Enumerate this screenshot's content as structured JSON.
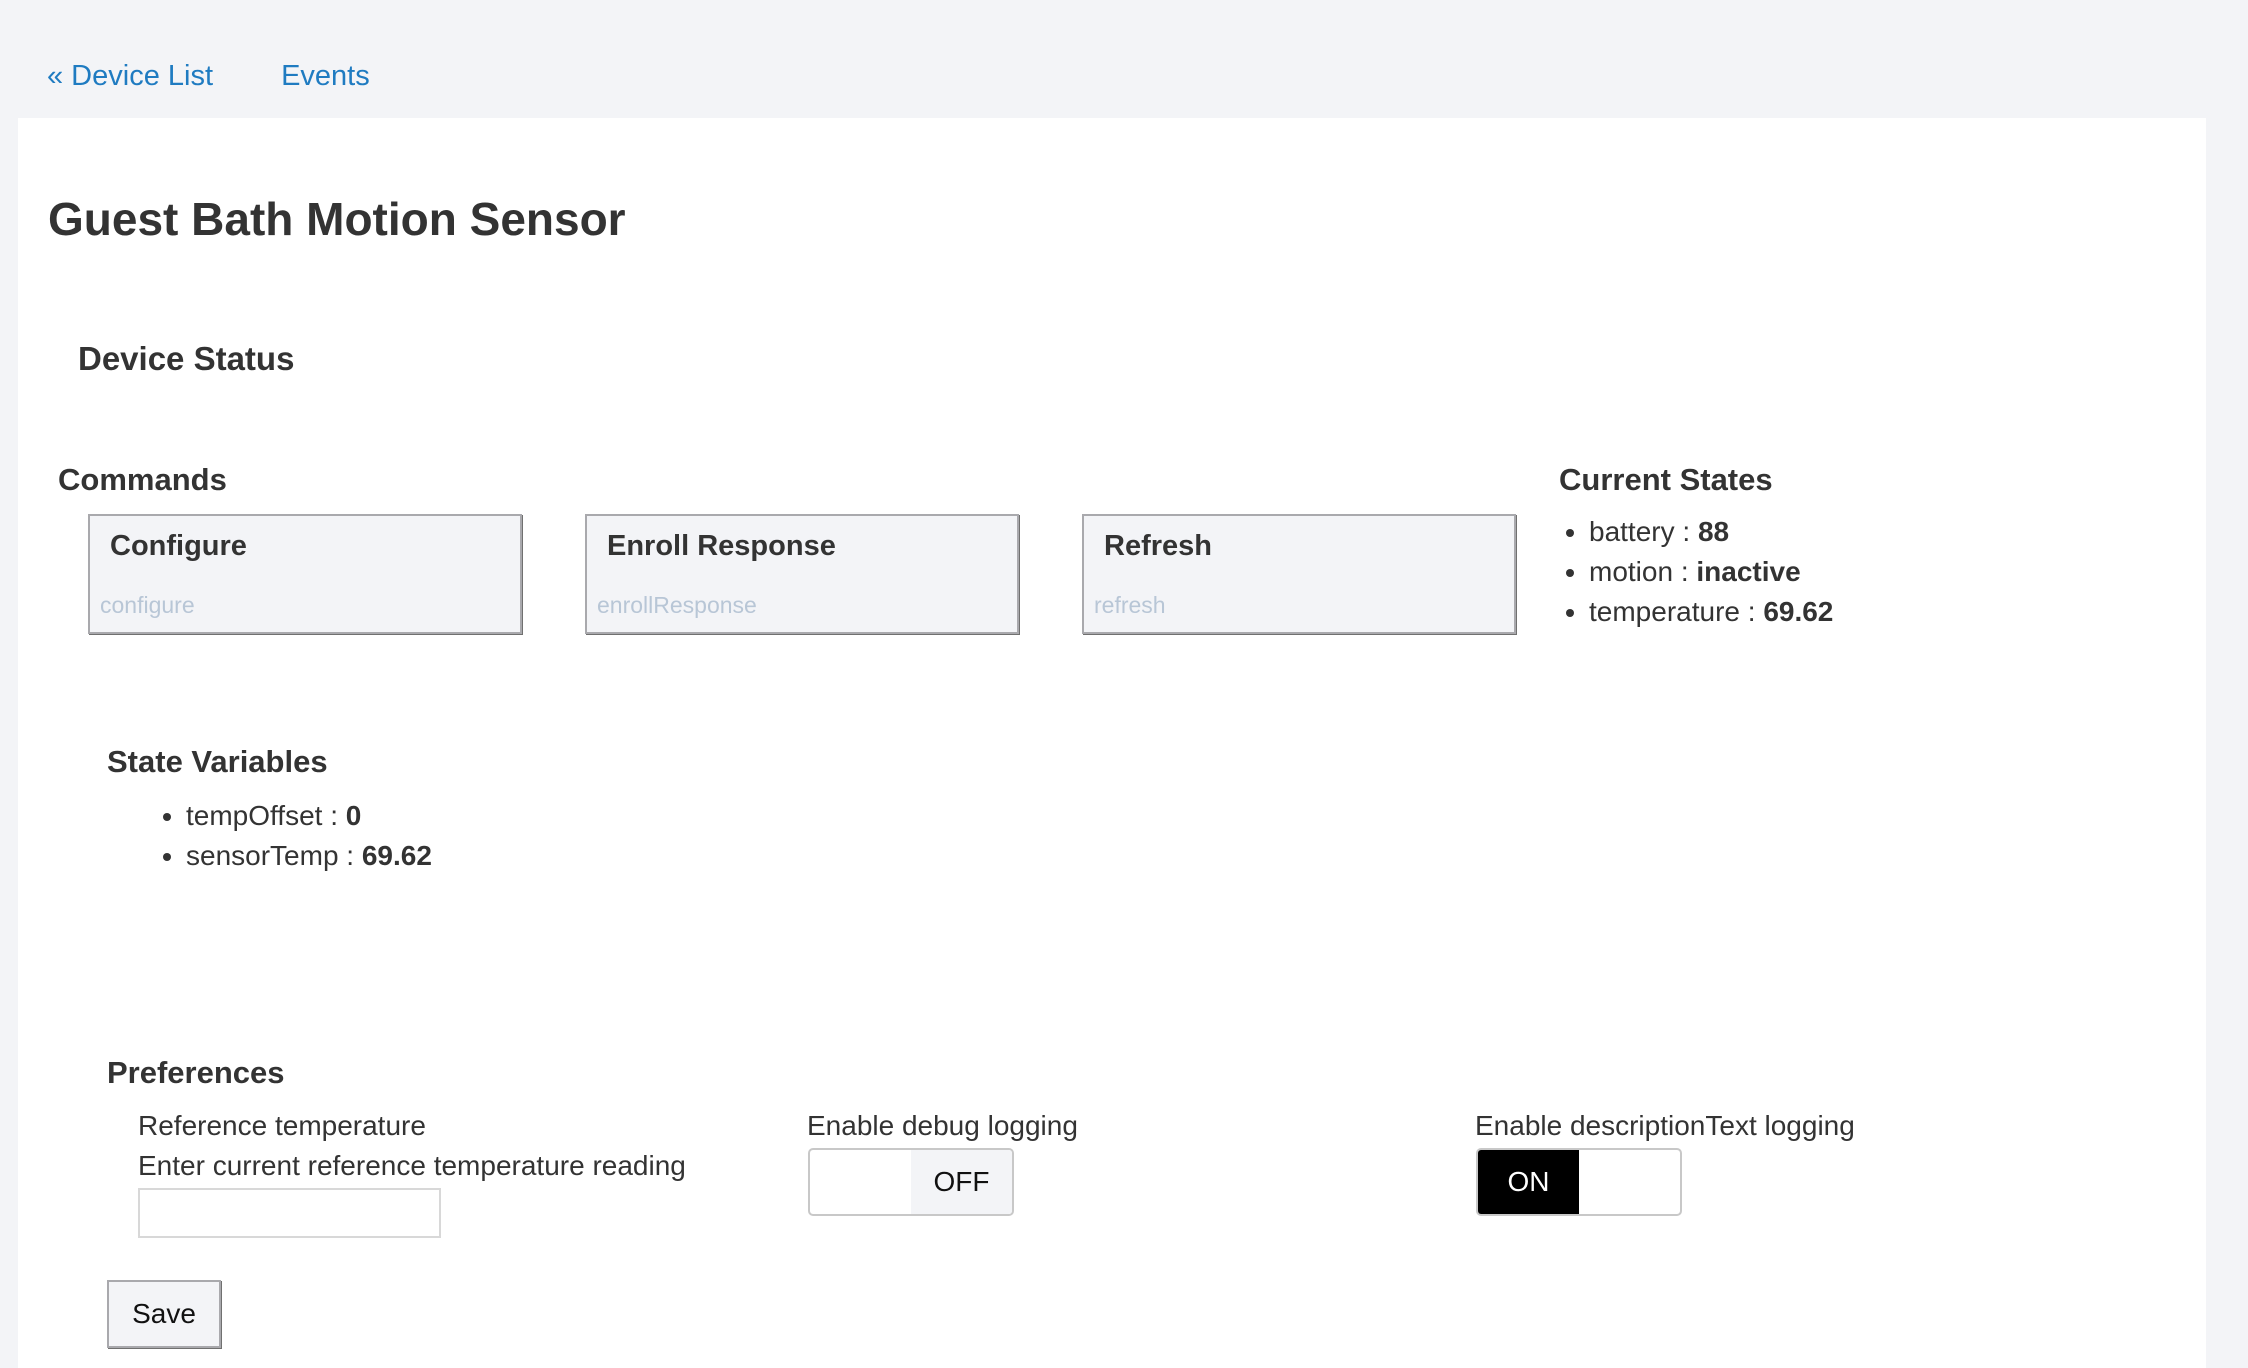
{
  "nav": {
    "device_list": "« Device List",
    "events": "Events"
  },
  "page": {
    "title": "Guest Bath Motion Sensor"
  },
  "device_status": {
    "title": "Device Status"
  },
  "commands": {
    "title": "Commands",
    "items": [
      {
        "label": "Configure",
        "command": "configure"
      },
      {
        "label": "Enroll Response",
        "command": "enrollResponse"
      },
      {
        "label": "Refresh",
        "command": "refresh"
      }
    ]
  },
  "current_states": {
    "title": "Current States",
    "items": [
      {
        "key": "battery",
        "value": "88"
      },
      {
        "key": "motion",
        "value": "inactive"
      },
      {
        "key": "temperature",
        "value": "69.62"
      }
    ]
  },
  "state_variables": {
    "title": "State Variables",
    "items": [
      {
        "key": "tempOffset",
        "value": "0"
      },
      {
        "key": "sensorTemp",
        "value": "69.62"
      }
    ]
  },
  "preferences": {
    "title": "Preferences",
    "ref_temp": {
      "label": "Reference temperature",
      "description": "Enter current reference temperature reading",
      "value": ""
    },
    "debug_logging": {
      "label": "Enable debug logging",
      "on_text": "",
      "off_text": "OFF",
      "state": "off"
    },
    "desc_logging": {
      "label": "Enable descriptionText logging",
      "on_text": "ON",
      "off_text": "",
      "state": "on"
    },
    "save_label": "Save"
  },
  "colors": {
    "link": "#1f7bc1",
    "background": "#f3f4f7",
    "panel": "#ffffff",
    "toggle_on": "#000000",
    "command_sub": "#b8c6d6"
  }
}
